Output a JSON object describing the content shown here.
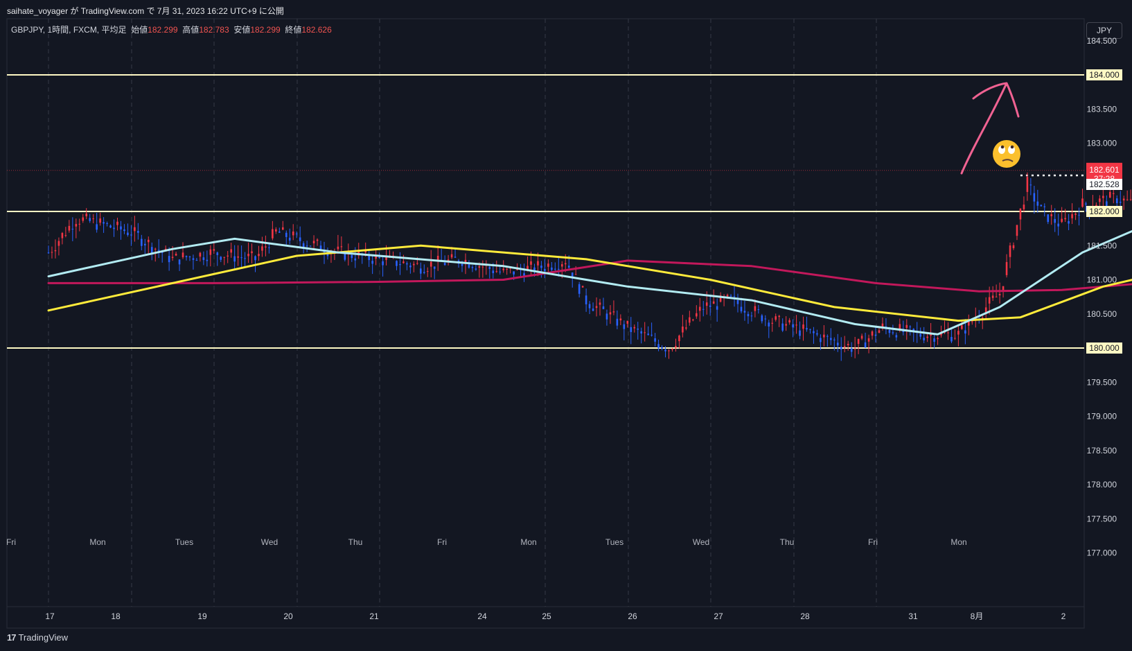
{
  "header": {
    "publish_line": "saihate_voyager が TradingView.com で 7月 31, 2023 16:22 UTC+9 に公開",
    "symbol": "GBPJPY, 1時間, FXCM, 平均足",
    "ohlc": [
      {
        "label": "始値",
        "value": "182.299"
      },
      {
        "label": "高値",
        "value": "182.783"
      },
      {
        "label": "安値",
        "value": "182.299"
      },
      {
        "label": "終値",
        "value": "182.626"
      }
    ],
    "currency_button": "JPY"
  },
  "footer": {
    "logo_text": "TradingView"
  },
  "colors": {
    "background": "#131722",
    "up": "#f23645",
    "down": "#2962ff",
    "level_line": "#fff9c4",
    "ma_fast": "#b2ebf2",
    "ma_mid": "#ffeb3b",
    "ma_slow": "#c2185b",
    "arrow": "#f06292"
  },
  "chart_data": {
    "type": "candlestick",
    "instrument": "GBPJPY",
    "price_axis": {
      "ticks": [
        "184.500",
        "184.000",
        "183.500",
        "183.000",
        "182.500",
        "182.000",
        "181.500",
        "181.000",
        "180.500",
        "180.000",
        "179.500",
        "179.000",
        "178.500",
        "178.000",
        "177.500",
        "177.000"
      ],
      "ylim": [
        176.6,
        184.55
      ]
    },
    "price_labels": [
      {
        "value": "184.000",
        "price": 184.0,
        "kind": "level"
      },
      {
        "value": "182.000",
        "price": 182.0,
        "kind": "level"
      },
      {
        "value": "180.000",
        "price": 180.0,
        "kind": "level"
      },
      {
        "value": "182.601",
        "time_left": "37:28",
        "price": 182.601,
        "kind": "last"
      },
      {
        "value": "182.528",
        "price": 182.528,
        "kind": "marker"
      }
    ],
    "horizontal_levels": [
      184.0,
      182.0,
      180.0
    ],
    "dotted_level": 182.528,
    "date_axis": [
      "17",
      "18",
      "19",
      "20",
      "21",
      "24",
      "25",
      "26",
      "27",
      "28",
      "31",
      "8月",
      "2"
    ],
    "day_labels": [
      "Fri",
      "Mon",
      "Tues",
      "Wed",
      "Thu",
      "Fri",
      "Mon",
      "Tues",
      "Wed",
      "Thu",
      "Fri",
      "Mon"
    ],
    "hours_per_day": 24,
    "price_series": [
      [
        0,
        181.4
      ],
      [
        8,
        181.9
      ],
      [
        24,
        181.7
      ],
      [
        36,
        181.3
      ],
      [
        48,
        181.4
      ],
      [
        60,
        181.3
      ],
      [
        66,
        181.7
      ],
      [
        72,
        181.6
      ],
      [
        84,
        181.4
      ],
      [
        96,
        181.3
      ],
      [
        108,
        181.2
      ],
      [
        120,
        181.3
      ],
      [
        132,
        181.1
      ],
      [
        144,
        181.2
      ],
      [
        150,
        181.3
      ],
      [
        156,
        180.7
      ],
      [
        168,
        180.3
      ],
      [
        180,
        180.0
      ],
      [
        190,
        180.6
      ],
      [
        198,
        180.7
      ],
      [
        210,
        180.4
      ],
      [
        222,
        180.2
      ],
      [
        234,
        180.0
      ],
      [
        242,
        180.3
      ],
      [
        252,
        180.2
      ],
      [
        264,
        180.2
      ],
      [
        270,
        180.5
      ],
      [
        276,
        180.8
      ],
      [
        280,
        181.6
      ],
      [
        284,
        182.4
      ],
      [
        288,
        182.0
      ],
      [
        294,
        181.8
      ],
      [
        300,
        182.1
      ],
      [
        310,
        182.2
      ],
      [
        320,
        182.0
      ],
      [
        330,
        182.0
      ],
      [
        334,
        182.1
      ],
      [
        340,
        181.4
      ],
      [
        346,
        181.1
      ],
      [
        352,
        181.1
      ],
      [
        360,
        181.3
      ],
      [
        372,
        181.4
      ],
      [
        384,
        181.3
      ],
      [
        396,
        181.8
      ],
      [
        408,
        181.7
      ],
      [
        420,
        181.8
      ],
      [
        432,
        181.5
      ],
      [
        444,
        181.3
      ],
      [
        456,
        181.4
      ],
      [
        468,
        181.4
      ],
      [
        480,
        181.5
      ],
      [
        492,
        181.4
      ],
      [
        504,
        181.4
      ],
      [
        516,
        181.6
      ],
      [
        528,
        181.5
      ],
      [
        534,
        181.3
      ],
      [
        540,
        180.4
      ],
      [
        546,
        178.6
      ],
      [
        552,
        178.0
      ],
      [
        558,
        178.5
      ],
      [
        564,
        178.2
      ],
      [
        570,
        177.8
      ],
      [
        576,
        178.1
      ],
      [
        582,
        178.8
      ],
      [
        588,
        179.4
      ],
      [
        594,
        180.6
      ],
      [
        600,
        181.1
      ],
      [
        606,
        181.3
      ],
      [
        612,
        181.2
      ],
      [
        618,
        181.3
      ],
      [
        621,
        181.9
      ],
      [
        624,
        182.2
      ],
      [
        630,
        182.6
      ]
    ],
    "ma_fast": [
      [
        0,
        181.05
      ],
      [
        36,
        181.45
      ],
      [
        54,
        181.6
      ],
      [
        84,
        181.4
      ],
      [
        132,
        181.2
      ],
      [
        168,
        180.9
      ],
      [
        204,
        180.7
      ],
      [
        234,
        180.35
      ],
      [
        258,
        180.2
      ],
      [
        276,
        180.6
      ],
      [
        300,
        181.4
      ],
      [
        330,
        182.05
      ],
      [
        360,
        181.6
      ],
      [
        390,
        181.35
      ],
      [
        420,
        181.55
      ],
      [
        456,
        181.6
      ],
      [
        492,
        181.5
      ],
      [
        516,
        181.55
      ],
      [
        534,
        181.4
      ],
      [
        552,
        180.3
      ],
      [
        570,
        179.4
      ],
      [
        588,
        178.9
      ],
      [
        600,
        178.85
      ],
      [
        610,
        179.5
      ],
      [
        624,
        180.6
      ],
      [
        630,
        180.95
      ]
    ],
    "ma_mid": [
      [
        0,
        180.55
      ],
      [
        36,
        180.95
      ],
      [
        72,
        181.35
      ],
      [
        108,
        181.5
      ],
      [
        156,
        181.3
      ],
      [
        192,
        181.0
      ],
      [
        228,
        180.6
      ],
      [
        264,
        180.4
      ],
      [
        282,
        180.45
      ],
      [
        306,
        180.9
      ],
      [
        336,
        181.25
      ],
      [
        372,
        181.5
      ],
      [
        402,
        181.75
      ],
      [
        432,
        181.55
      ],
      [
        468,
        181.5
      ],
      [
        498,
        181.55
      ],
      [
        528,
        181.55
      ],
      [
        546,
        181.2
      ],
      [
        570,
        180.5
      ],
      [
        594,
        180.15
      ],
      [
        612,
        180.1
      ],
      [
        624,
        180.15
      ],
      [
        630,
        180.22
      ]
    ],
    "ma_slow": [
      [
        0,
        180.95
      ],
      [
        48,
        180.95
      ],
      [
        96,
        180.97
      ],
      [
        132,
        181.0
      ],
      [
        168,
        181.28
      ],
      [
        204,
        181.2
      ],
      [
        240,
        180.95
      ],
      [
        270,
        180.83
      ],
      [
        294,
        180.85
      ],
      [
        330,
        181.0
      ],
      [
        372,
        181.0
      ],
      [
        420,
        181.05
      ],
      [
        456,
        181.25
      ],
      [
        492,
        181.55
      ],
      [
        528,
        181.62
      ],
      [
        552,
        181.45
      ],
      [
        576,
        181.05
      ],
      [
        600,
        180.85
      ],
      [
        618,
        180.83
      ],
      [
        630,
        180.88
      ]
    ],
    "annotations": [
      {
        "type": "arrow",
        "description": "hand-drawn up arrow toward 184.000"
      },
      {
        "type": "emoji",
        "description": "eye-roll face"
      }
    ]
  }
}
